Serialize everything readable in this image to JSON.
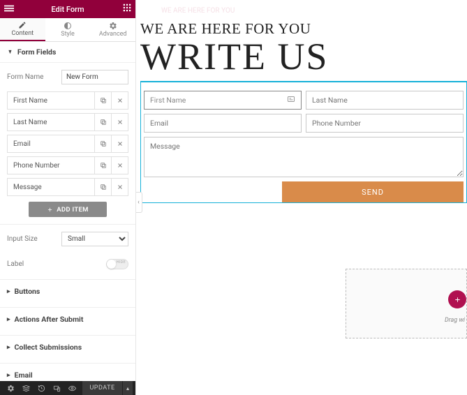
{
  "panel": {
    "title": "Edit Form",
    "tabs": {
      "content": "Content",
      "style": "Style",
      "advanced": "Advanced"
    }
  },
  "form_fields": {
    "section_title": "Form Fields",
    "form_name_label": "Form Name",
    "form_name_value": "New Form",
    "items": [
      {
        "label": "First Name"
      },
      {
        "label": "Last Name"
      },
      {
        "label": "Email"
      },
      {
        "label": "Phone Number"
      },
      {
        "label": "Message"
      }
    ],
    "add_item": "ADD ITEM",
    "input_size_label": "Input Size",
    "input_size_value": "Small",
    "label_label": "Label",
    "label_toggle_text": "HIDE"
  },
  "sections": {
    "buttons": "Buttons",
    "actions": "Actions After Submit",
    "collect": "Collect Submissions",
    "email": "Email"
  },
  "bottom": {
    "update": "UPDATE"
  },
  "preview": {
    "faint": "WE ARE HERE FOR YOU",
    "subheading": "WE ARE HERE FOR YOU",
    "heading": "WRITE US",
    "first_name": "First Name",
    "last_name": "Last Name",
    "email": "Email",
    "phone": "Phone Number",
    "message": "Message",
    "send": "SEND",
    "drag": "Drag wi"
  }
}
